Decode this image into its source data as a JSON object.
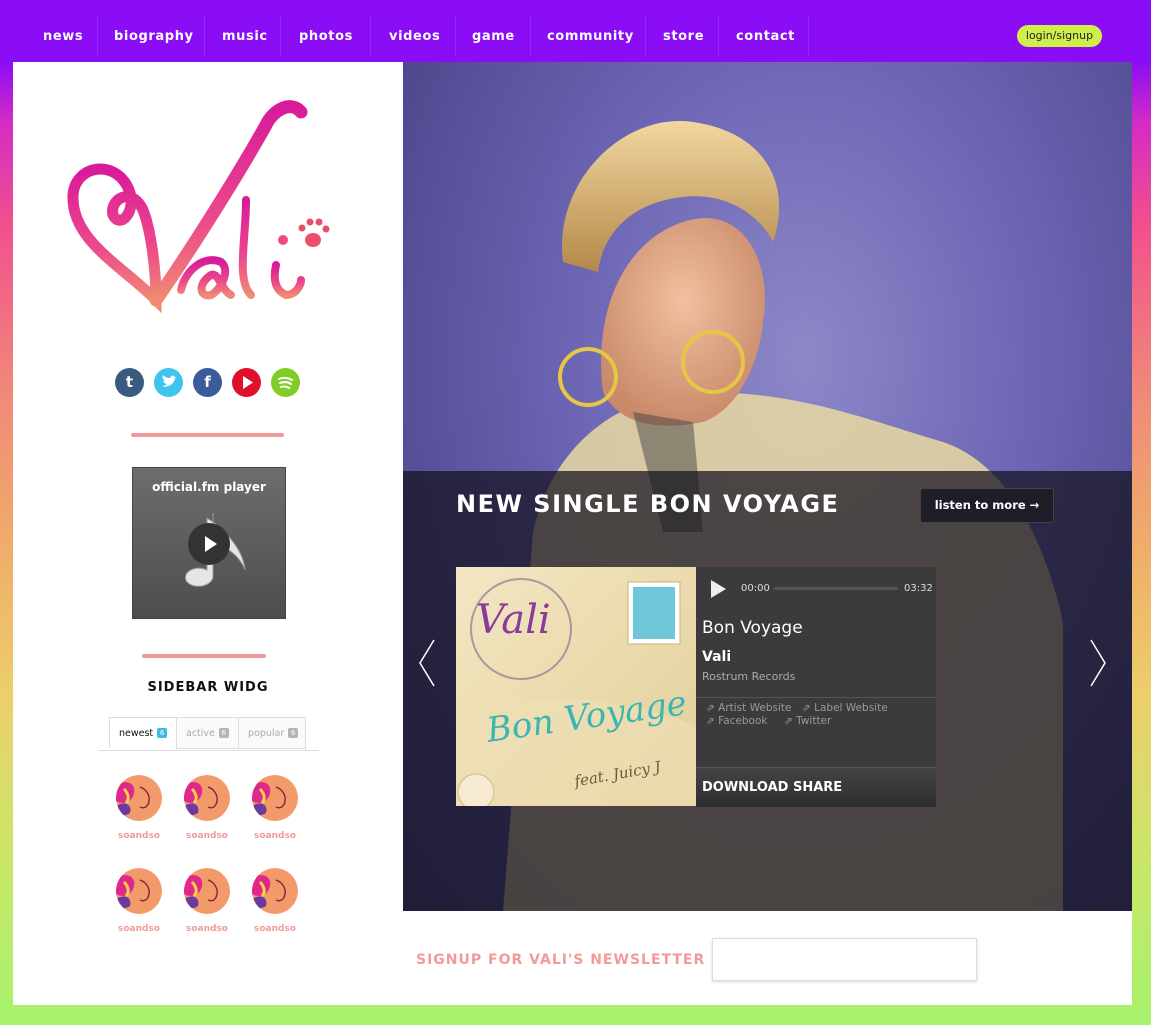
{
  "nav": {
    "items": [
      "news",
      "biography",
      "music",
      "photos",
      "videos",
      "game",
      "community",
      "store",
      "contact"
    ],
    "login_label": "login/signup"
  },
  "sidebar": {
    "logo_text": "Vali",
    "social_icons": [
      {
        "name": "tumblr-icon",
        "glyph": "t",
        "color": "#3a5a7e"
      },
      {
        "name": "twitter-icon",
        "glyph": "twitter",
        "color": "#3ec4ee"
      },
      {
        "name": "facebook-icon",
        "glyph": "f",
        "color": "#3b5b9a"
      },
      {
        "name": "youtube-icon",
        "glyph": "play",
        "color": "#e0102a"
      },
      {
        "name": "spotify-icon",
        "glyph": "spotify",
        "color": "#80cd2a"
      }
    ],
    "player_title": "official.fm player",
    "widget_title": "SIDEBAR WIDG",
    "tabs": [
      {
        "label": "newest",
        "count": "6",
        "color": "#3dbde6"
      },
      {
        "label": "active",
        "count": "6",
        "color": "#b5b5b5"
      },
      {
        "label": "popular",
        "count": "6",
        "color": "#b5b5b5"
      }
    ],
    "avatars": [
      "soandso",
      "soandso",
      "soandso",
      "soandso",
      "soandso",
      "soandso"
    ]
  },
  "hero": {
    "title": "NEW SINGLE BON VOYAGE",
    "listen_label": "listen to  more →",
    "album_title": "Bon Voyage",
    "album_feat": "feat. Juicy J",
    "album_brand": "Vali",
    "track": {
      "time_current": "00:00",
      "time_total": "03:32",
      "song": "Bon Voyage",
      "artist": "Vali",
      "label": "Rostrum Records",
      "links": [
        "Artist Website",
        "Label Website",
        "Facebook",
        "Twitter"
      ],
      "download_label": "DOWNLOAD SHARE"
    }
  },
  "newsletter": {
    "label": "SIGNUP FOR VALI'S  NEWSLETTER",
    "placeholder": ""
  }
}
